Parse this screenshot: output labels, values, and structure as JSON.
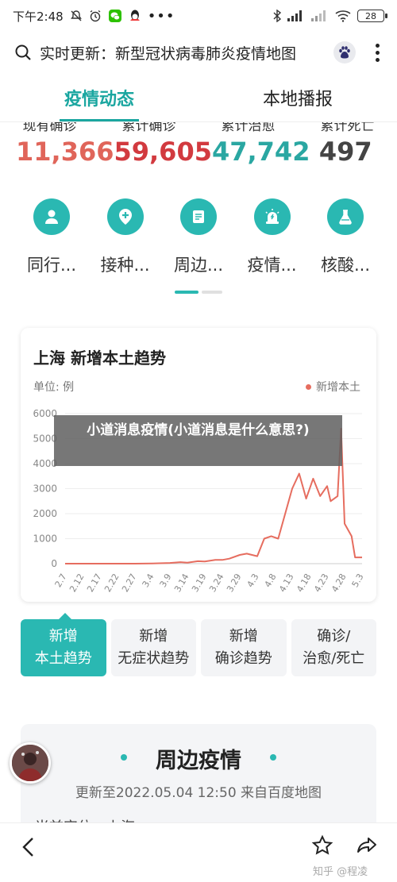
{
  "status_bar": {
    "time": "下午2:48",
    "battery": "28"
  },
  "address_bar": {
    "title": "实时更新：新型冠状病毒肺炎疫情地图"
  },
  "tabs": [
    {
      "label": "疫情动态",
      "active": true
    },
    {
      "label": "本地播报",
      "active": false
    }
  ],
  "stats": {
    "labels": [
      "现有确诊",
      "累计确诊",
      "累计治愈",
      "累计死亡"
    ],
    "items": [
      {
        "value": "11,366",
        "color": "#e0655a"
      },
      {
        "value": "59,605",
        "color": "#d23a3f"
      },
      {
        "value": "47,742",
        "color": "#2aa7a2"
      },
      {
        "value": "497",
        "color": "#444444"
      }
    ]
  },
  "shortcuts": [
    {
      "label": "同行...",
      "icon": "user-icon"
    },
    {
      "label": "接种...",
      "icon": "location-plus-icon"
    },
    {
      "label": "周边...",
      "icon": "document-icon"
    },
    {
      "label": "疫情...",
      "icon": "siren-icon"
    },
    {
      "label": "核酸...",
      "icon": "flask-icon"
    }
  ],
  "chart_card": {
    "title": "上海 新增本土趋势",
    "unit": "单位: 例",
    "legend": "新增本土"
  },
  "chart_data": {
    "type": "line",
    "title": "上海 新增本土趋势",
    "ylabel": "单位: 例",
    "ylim": [
      0,
      6000
    ],
    "yticks": [
      0,
      1000,
      2000,
      3000,
      4000,
      5000,
      6000
    ],
    "xticks": [
      "2.7",
      "2.12",
      "2.17",
      "2.22",
      "2.27",
      "3.4",
      "3.9",
      "3.14",
      "3.19",
      "3.24",
      "3.29",
      "4.3",
      "4.8",
      "4.13",
      "4.18",
      "4.23",
      "4.28",
      "5.3"
    ],
    "grid": true,
    "legend_position": "top-right",
    "series": [
      {
        "name": "新增本土",
        "color": "#e66d5f",
        "x": [
          "2.7",
          "2.12",
          "2.17",
          "2.22",
          "2.27",
          "3.4",
          "3.9",
          "3.12",
          "3.14",
          "3.17",
          "3.19",
          "3.22",
          "3.24",
          "3.26",
          "3.29",
          "3.31",
          "4.3",
          "4.5",
          "4.7",
          "4.9",
          "4.11",
          "4.13",
          "4.15",
          "4.17",
          "4.19",
          "4.21",
          "4.23",
          "4.24",
          "4.26",
          "4.27",
          "4.28",
          "4.30",
          "5.1",
          "5.3"
        ],
        "y": [
          0,
          0,
          0,
          0,
          0,
          10,
          30,
          60,
          40,
          100,
          90,
          150,
          150,
          200,
          350,
          400,
          300,
          1000,
          1100,
          1000,
          2000,
          3000,
          3600,
          2600,
          3400,
          2700,
          3100,
          2500,
          2700,
          5400,
          1600,
          1100,
          250,
          250
        ]
      }
    ]
  },
  "overlay_banner": {
    "text": "小道消息疫情(小道消息是什么意思?)"
  },
  "trend_buttons": [
    {
      "line1": "新增",
      "line2": "本土趋势",
      "active": true
    },
    {
      "line1": "新增",
      "line2": "无症状趋势",
      "active": false
    },
    {
      "line1": "新增",
      "line2": "确诊趋势",
      "active": false
    },
    {
      "line1": "确诊/",
      "line2": "治愈/死亡",
      "active": false
    }
  ],
  "nearby": {
    "title": "周边疫情",
    "subtitle": "更新至2022.05.04 12:50  来自百度地图",
    "location": "当前定位：上海"
  },
  "bottom_bar": {
    "watermark": "知乎 @程凌"
  }
}
